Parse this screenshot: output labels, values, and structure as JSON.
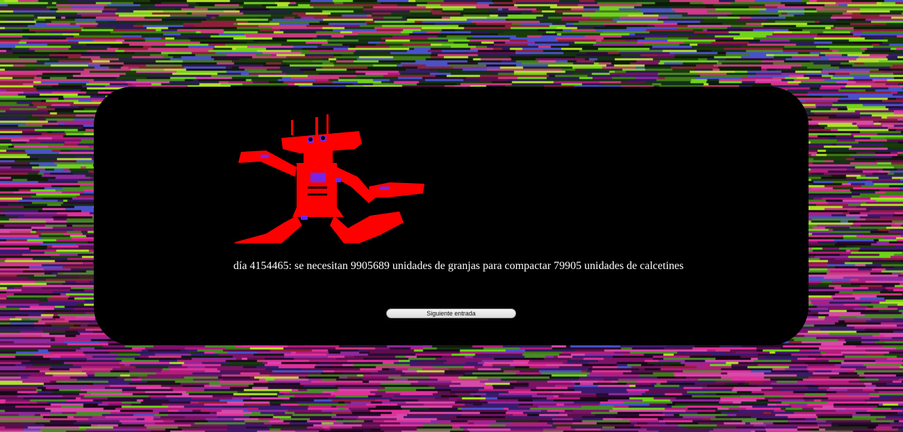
{
  "entry": {
    "text": "día 4154465: se necesitan 9905689 unidades de granjas para compactar 79905 unidades de calcetines"
  },
  "controls": {
    "next_label": "Siguiente entrada"
  },
  "colors": {
    "panel": "#000000",
    "robot_primary": "#ff0000",
    "robot_secondary": "#6a2bff"
  }
}
